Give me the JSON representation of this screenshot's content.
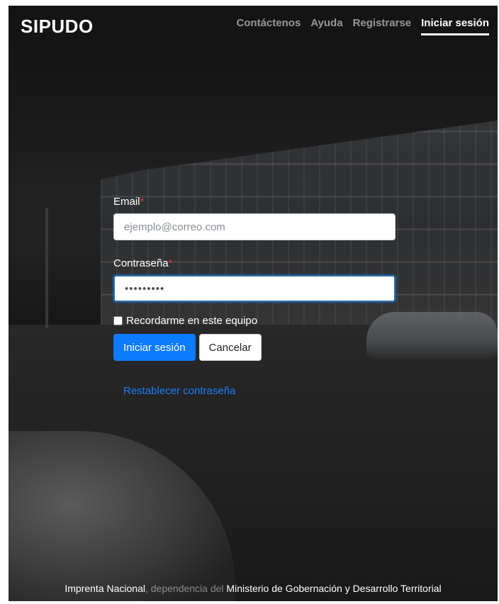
{
  "header": {
    "brand": "SIPUDO",
    "nav": [
      {
        "label": "Contáctenos",
        "active": false
      },
      {
        "label": "Ayuda",
        "active": false
      },
      {
        "label": "Registrarse",
        "active": false
      },
      {
        "label": "Iniciar sesión",
        "active": true
      }
    ]
  },
  "form": {
    "email_label": "Email",
    "required_mark": "*",
    "email_placeholder": "ejemplo@correo.com",
    "email_value": "",
    "password_label": "Contraseña",
    "password_value": "•••••••••",
    "remember_label": "Recordarme en este equipo",
    "remember_checked": false,
    "submit_label": "Iniciar sesión",
    "cancel_label": "Cancelar",
    "reset_link": "Restablecer contraseña"
  },
  "footer": {
    "org": "Imprenta Nacional",
    "connector": ", dependencia del ",
    "ministry": "Ministerio de Gobernación y Desarrollo Territorial"
  },
  "colors": {
    "primary": "#0d7bfd",
    "link": "#1a7cf5",
    "required": "#dc3545"
  }
}
